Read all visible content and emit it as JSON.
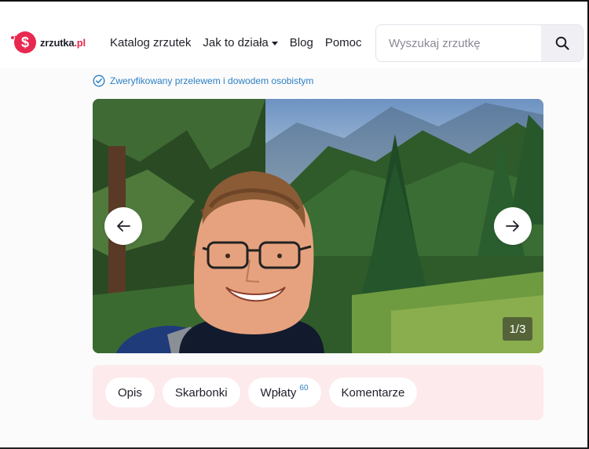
{
  "header": {
    "logo": {
      "name": "zrzutka",
      "tld": ".pl"
    },
    "nav": [
      {
        "label": "Katalog zrzutek",
        "has_dropdown": false
      },
      {
        "label": "Jak to działa",
        "has_dropdown": true
      },
      {
        "label": "Blog",
        "has_dropdown": false
      },
      {
        "label": "Pomoc",
        "has_dropdown": false
      }
    ],
    "search": {
      "placeholder": "Wyszukaj zrzutkę",
      "value": "",
      "icon": "search-icon"
    }
  },
  "verified": {
    "text": "Zweryfikowany przelewem i dowodem osobistym",
    "icon": "check-circle-icon"
  },
  "gallery": {
    "counter": "1/3",
    "current": 1,
    "total": 3,
    "prev_icon": "arrow-left-icon",
    "next_icon": "arrow-right-icon"
  },
  "tabs": [
    {
      "label": "Opis",
      "badge": ""
    },
    {
      "label": "Skarbonki",
      "badge": ""
    },
    {
      "label": "Wpłaty",
      "badge": "60"
    },
    {
      "label": "Komentarze",
      "badge": ""
    }
  ],
  "colors": {
    "brand_red": "#e8284e",
    "link_blue": "#2c7fc2",
    "tabs_background": "#fdeaec"
  }
}
